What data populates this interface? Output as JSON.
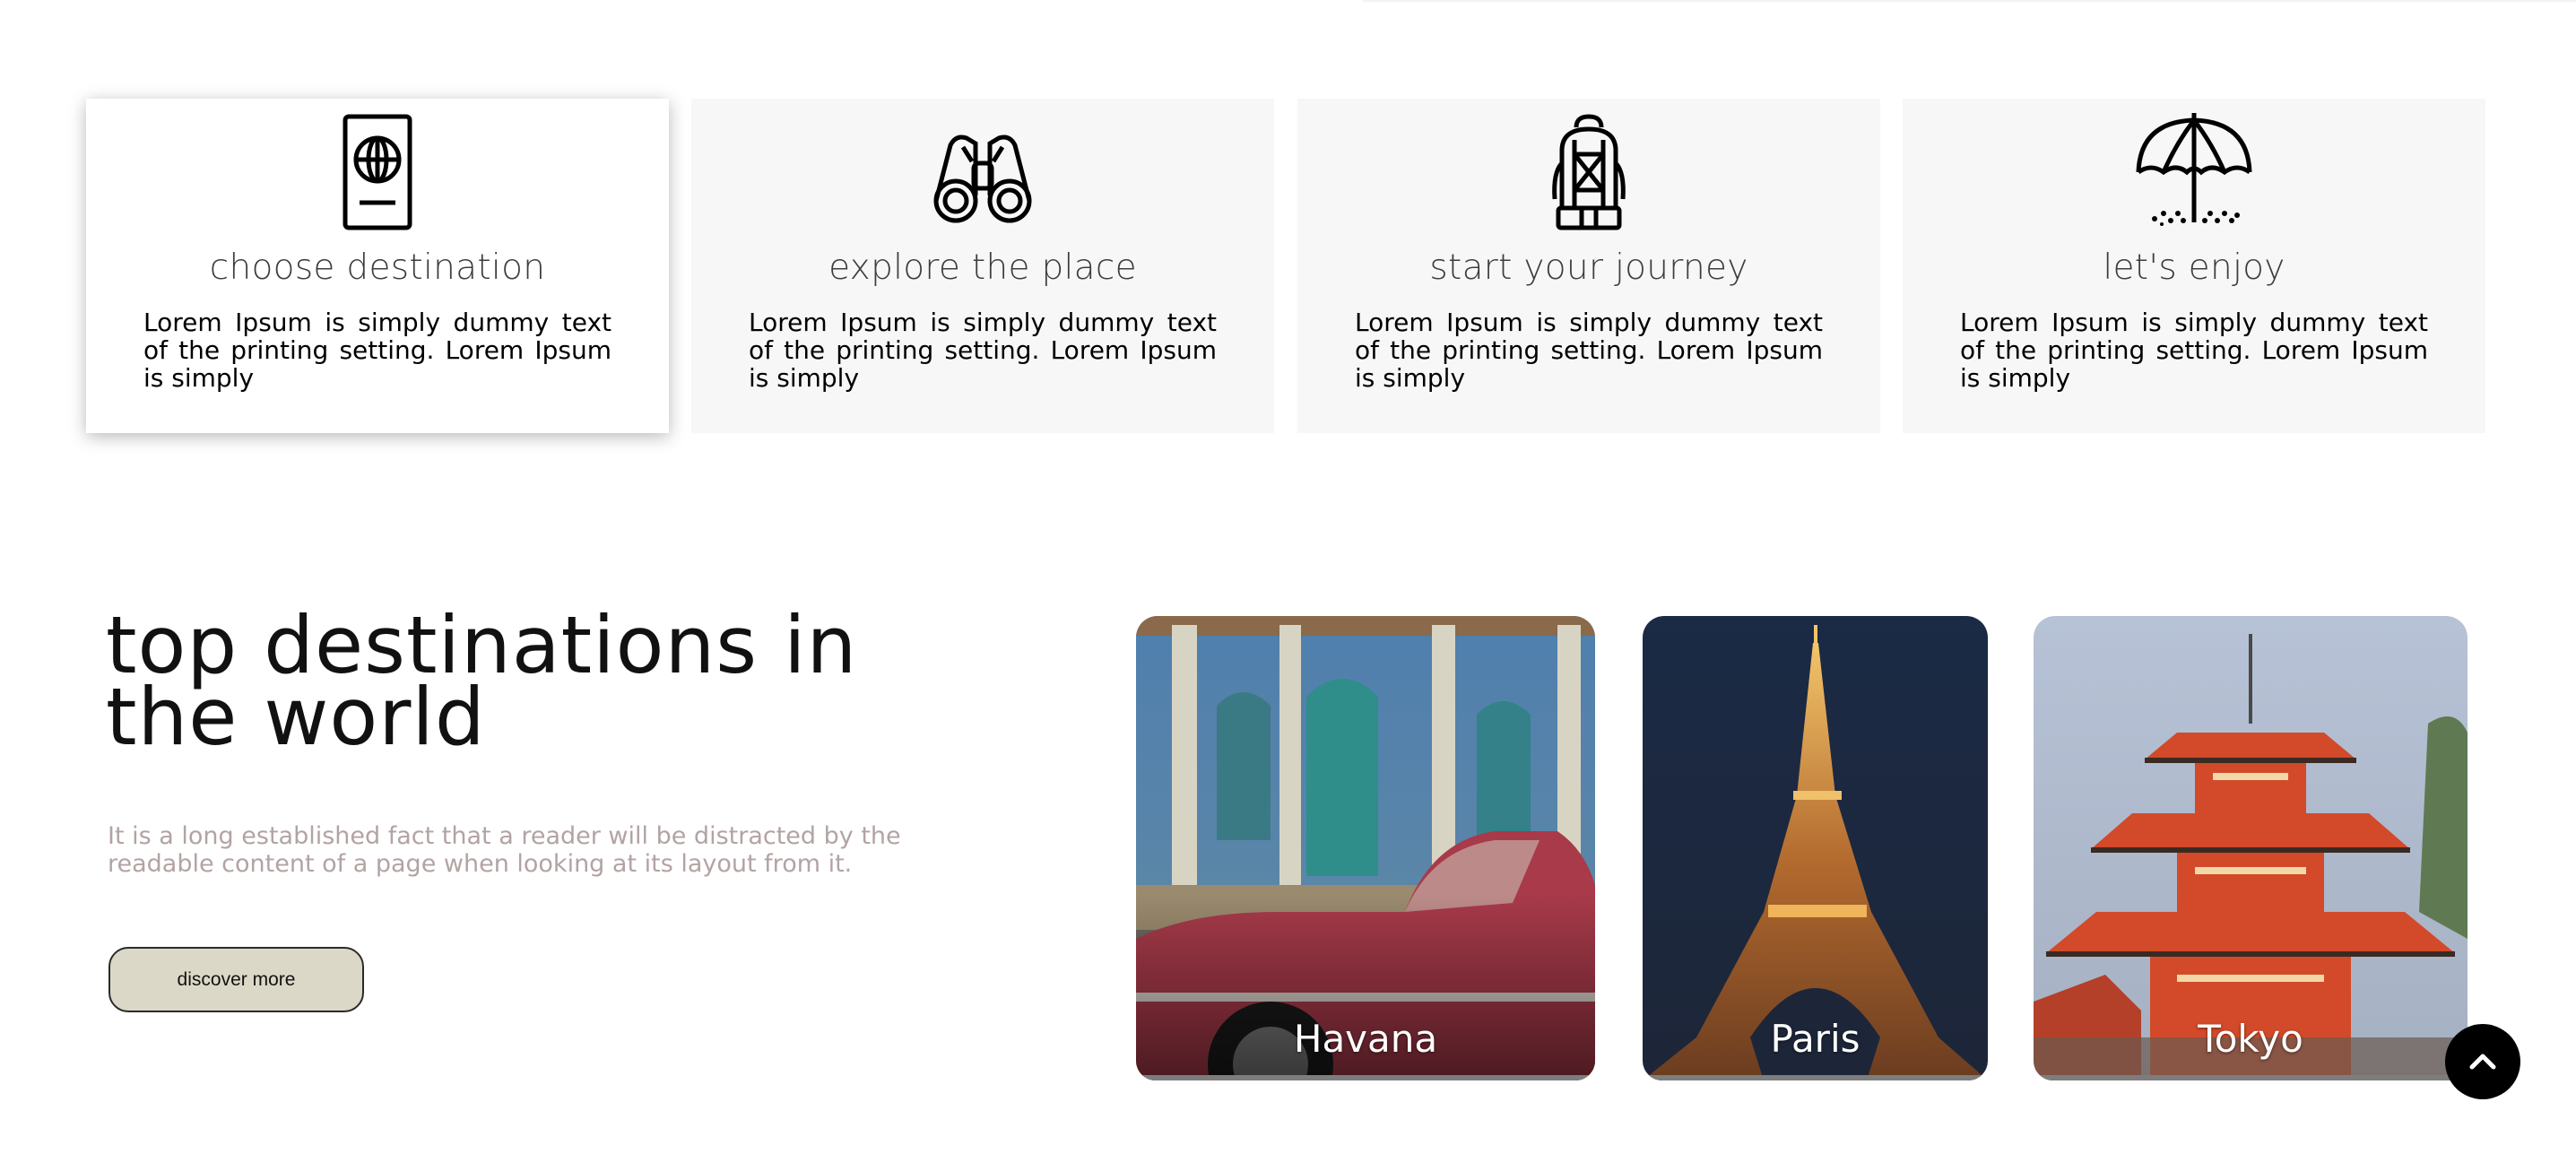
{
  "features": [
    {
      "icon": "passport-icon",
      "title": "choose destination",
      "text": "Lorem Ipsum is simply dummy text of the printing setting. Lorem Ipsum is simply",
      "active": true
    },
    {
      "icon": "binoculars-icon",
      "title": "explore the place",
      "text": "Lorem Ipsum is simply dummy text of the printing setting. Lorem Ipsum is simply",
      "active": false
    },
    {
      "icon": "backpack-icon",
      "title": "start your journey",
      "text": "Lorem Ipsum is simply dummy text of the printing setting. Lorem Ipsum is simply",
      "active": false
    },
    {
      "icon": "beach-umbrella-icon",
      "title": "let's enjoy",
      "text": "Lorem Ipsum is simply dummy text of the printing setting. Lorem Ipsum is simply",
      "active": false
    }
  ],
  "destinations": {
    "title": "top destinations in the world",
    "description": "It is a long established fact that a reader will be distracted by the readable content of a page when looking at its layout from it.",
    "button_label": "discover more",
    "cities": [
      {
        "name": "Havana"
      },
      {
        "name": "Paris"
      },
      {
        "name": "Tokyo"
      }
    ]
  },
  "scroll_top": {
    "icon": "chevron-up-icon"
  },
  "colors": {
    "card_bg": "#f7f7f7",
    "button_bg": "#dcd8c7",
    "description_text": "#b3a3a3"
  }
}
